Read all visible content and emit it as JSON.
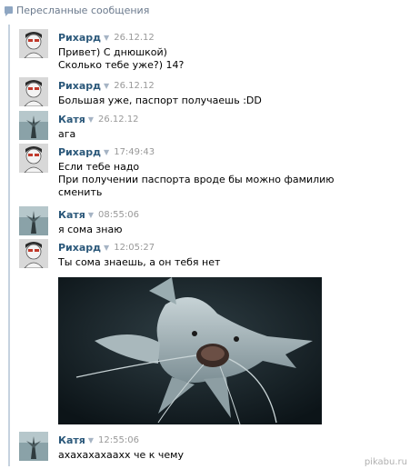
{
  "header": {
    "title": "Пересланные сообщения"
  },
  "messages": [
    {
      "author": "Рихард",
      "time": "26.12.12",
      "lines": [
        "Привет) С днюшкой)",
        "Сколько тебе уже?) 14?"
      ]
    },
    {
      "author": "Рихард",
      "time": "26.12.12",
      "lines": [
        "Большая уже, паспорт получаешь :DD"
      ]
    },
    {
      "author": "Катя",
      "time": "26.12.12",
      "lines": [
        "ага"
      ]
    },
    {
      "author": "Рихард",
      "time": "17:49:43",
      "lines": [
        "Если тебе надо",
        "При получении паспорта вроде бы можно фамилию",
        "сменить"
      ]
    },
    {
      "author": "Катя",
      "time": "08:55:06",
      "lines": [
        "я сома знаю"
      ]
    },
    {
      "author": "Рихард",
      "time": "12:05:27",
      "lines": [
        "Ты сома знаешь, а он тебя нет"
      ]
    },
    {
      "author": "Катя",
      "time": "12:55:06",
      "lines": [
        "ахахахахааxx че к чему"
      ]
    }
  ],
  "photo": {
    "subject": "catfish-underwater"
  },
  "watermark": "pikabu.ru",
  "colors": {
    "author": "#2b587a",
    "time": "#999999",
    "thread": "#c6d2df"
  }
}
